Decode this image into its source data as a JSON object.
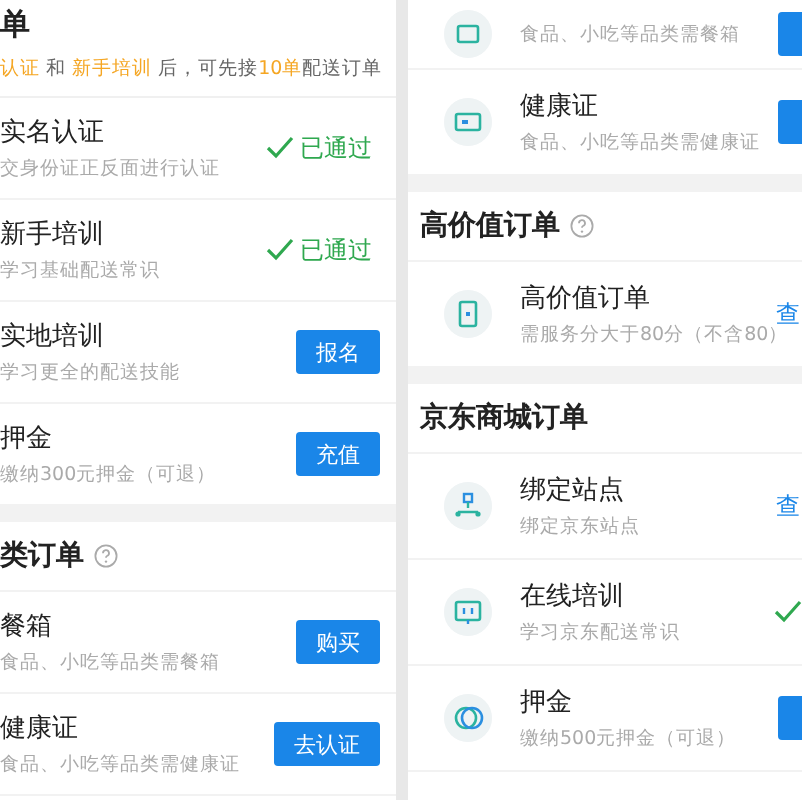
{
  "panels": [
    {
      "items": [
        {
          "kind": "intro",
          "title": "单",
          "segments": [
            {
              "text": "认证",
              "highlight": true
            },
            {
              "text": " 和 ",
              "highlight": false
            },
            {
              "text": "新手培训",
              "highlight": true
            },
            {
              "text": " 后，可先接",
              "highlight": false
            },
            {
              "text": "10单",
              "highlight": true
            },
            {
              "text": "配送订单",
              "highlight": false
            }
          ]
        },
        {
          "kind": "row",
          "title": "实名认证",
          "desc": "交身份证正反面进行认证",
          "action": {
            "kind": "passed",
            "label": "已通过"
          }
        },
        {
          "kind": "row",
          "title": "新手培训",
          "desc": "学习基础配送常识",
          "action": {
            "kind": "passed",
            "label": "已通过"
          }
        },
        {
          "kind": "row",
          "title": "实地培训",
          "desc": "学习更全的配送技能",
          "action": {
            "kind": "button",
            "label": "报名"
          }
        },
        {
          "kind": "row",
          "title": "押金",
          "desc": "缴纳300元押金（可退）",
          "action": {
            "kind": "button",
            "label": "充值"
          }
        },
        {
          "kind": "gap"
        },
        {
          "kind": "section",
          "title": "类订单",
          "help": true
        },
        {
          "kind": "row",
          "title": "餐箱",
          "desc": "食品、小吃等品类需餐箱",
          "action": {
            "kind": "button",
            "label": "购买"
          }
        },
        {
          "kind": "row",
          "title": "健康证",
          "desc": "食品、小吃等品类需健康证",
          "action": {
            "kind": "button",
            "label": "去认证"
          }
        }
      ]
    },
    {
      "items": [
        {
          "kind": "row",
          "desc": "食品、小吃等品类需餐箱",
          "action": {
            "kind": "button"
          }
        },
        {
          "kind": "row",
          "title": "健康证",
          "desc": "食品、小吃等品类需健康证",
          "action": {
            "kind": "button"
          }
        },
        {
          "kind": "gap"
        },
        {
          "kind": "section",
          "title": "高价值订单",
          "help": true
        },
        {
          "kind": "row",
          "title": "高价值订单",
          "desc": "需服务分大于80分（不含80）",
          "action": {
            "kind": "link",
            "label": "查"
          }
        },
        {
          "kind": "gap"
        },
        {
          "kind": "section",
          "title": "京东商城订单",
          "help": false
        },
        {
          "kind": "row",
          "title": "绑定站点",
          "desc": "绑定京东站点",
          "action": {
            "kind": "link",
            "label": "查"
          }
        },
        {
          "kind": "row",
          "title": "在线培训",
          "desc": "学习京东配送常识",
          "action": {
            "kind": "passed"
          }
        },
        {
          "kind": "row",
          "title": "押金",
          "desc": "缴纳500元押金（可退）",
          "action": {
            "kind": "button"
          }
        }
      ]
    }
  ]
}
